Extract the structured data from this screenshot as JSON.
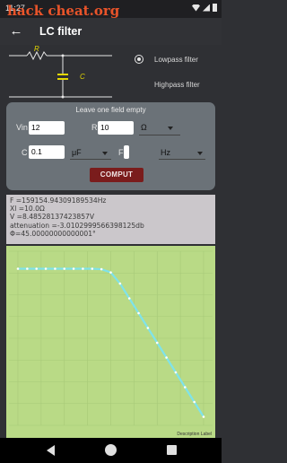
{
  "status": {
    "time": "11:27",
    "watermark": "hack cheat.org"
  },
  "appbar": {
    "title": "LC filter",
    "back_icon": "arrow-left-icon"
  },
  "circuit": {
    "r_label": "R",
    "c_label": "C"
  },
  "filter_type": {
    "options": [
      "Lowpass filter",
      "Highpass filter"
    ],
    "selected": "Lowpass filter"
  },
  "form": {
    "hint": "Leave one field empty",
    "vin_label": "Vin",
    "vin_value": "12",
    "r_label": "R",
    "r_value": "10",
    "r_unit": "Ω",
    "c_label": "C",
    "c_value": "0.1",
    "c_unit": "μF",
    "f_label": "F",
    "f_value": "",
    "f_unit": "Hz",
    "compute_label": "COMPUT"
  },
  "results": {
    "f": "F =159154.94309189534Hz",
    "xl": "Xl =10.0Ω",
    "v": "V =8.48528137423857V",
    "attenuation": "attenuation =-3.0102999566398125db",
    "phase": "Φ=45.00000000000001°"
  },
  "chart_data": {
    "type": "line",
    "description_label": "Description Label",
    "background": "#b9da86",
    "line_color": "#7fe3ea",
    "x": [
      0,
      5,
      10,
      15,
      20,
      25,
      30,
      35,
      40,
      45,
      50,
      55,
      60,
      65,
      70,
      75,
      80,
      85,
      90,
      95,
      100
    ],
    "series": [
      {
        "values": [
          0,
          0,
          0,
          0,
          0,
          0,
          0,
          0,
          0,
          -0.2,
          -1.5,
          -6,
          -12,
          -18,
          -24,
          -30,
          -36,
          -42,
          -48,
          -54,
          -60
        ]
      }
    ],
    "ylim": [
      -62,
      2
    ],
    "xlim": [
      0,
      100
    ],
    "grid": true
  }
}
